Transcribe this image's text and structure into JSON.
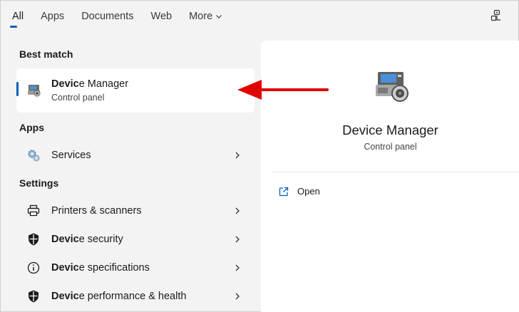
{
  "tabs": [
    {
      "label": "All",
      "active": true
    },
    {
      "label": "Apps"
    },
    {
      "label": "Documents"
    },
    {
      "label": "Web"
    },
    {
      "label": "More"
    }
  ],
  "sections": {
    "best_match": "Best match",
    "apps": "Apps",
    "settings": "Settings"
  },
  "best_match": {
    "title_bold": "Devic",
    "title_rest": "e Manager",
    "subtitle": "Control panel",
    "icon": "device-manager-icon"
  },
  "apps": [
    {
      "label": "Services",
      "icon": "gear-icon"
    }
  ],
  "settings": [
    {
      "label_bold": "",
      "label_rest": "Printers & scanners",
      "icon": "printer-icon"
    },
    {
      "label_bold": "Devic",
      "label_rest": "e security",
      "icon": "shield-icon"
    },
    {
      "label_bold": "Devic",
      "label_rest": "e specifications",
      "icon": "info-icon"
    },
    {
      "label_bold": "Devic",
      "label_rest": "e performance & health",
      "icon": "shield-icon"
    }
  ],
  "preview": {
    "title": "Device Manager",
    "subtitle": "Control panel",
    "actions": [
      {
        "label": "Open",
        "icon": "open-external-icon"
      }
    ]
  },
  "colors": {
    "accent": "#005fb8",
    "arrow": "#e00000",
    "background": "#f3f3f3",
    "panel": "#ffffff"
  }
}
